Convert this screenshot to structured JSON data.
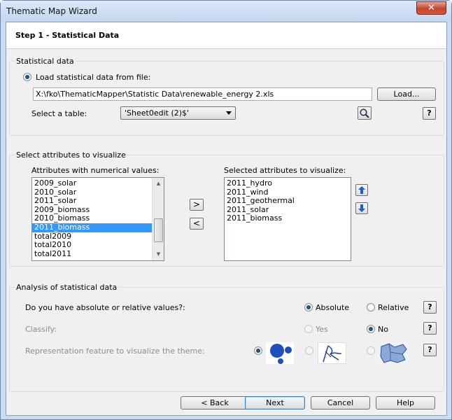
{
  "window": {
    "title": "Thematic Map Wizard",
    "close_glyph": "✕"
  },
  "header": {
    "step_title": "Step 1 - Statistical Data"
  },
  "statistical": {
    "group_label": "Statistical data",
    "load_radio_label": "Load statistical data from file:",
    "file_path": "X:\\fko\\ThematicMapper\\Statistic Data\\renewable_energy 2.xls",
    "load_button": "Load...",
    "select_table_label": "Select a table:",
    "table_value": "'Sheet0edit (2)$'",
    "help_label": "?"
  },
  "attributes": {
    "group_label": "Select attributes to visualize",
    "numerical_label": "Attributes with numerical values:",
    "numerical_items": [
      "2009_solar",
      "2010_solar",
      "2011_solar",
      "2009_biomass",
      "2010_biomass",
      "2011_biomass",
      "total2009",
      "total2010",
      "total2011"
    ],
    "selected_index": 5,
    "add_label": ">",
    "remove_label": "<",
    "selected_label": "Selected attributes to visualize:",
    "selected_items": [
      "2011_hydro",
      "2011_wind",
      "2011_geothermal",
      "2011_solar",
      "2011_biomass"
    ]
  },
  "analysis": {
    "group_label": "Analysis of statistical data",
    "values_question": "Do you have absolute or relative values?:",
    "absolute_label": "Absolute",
    "relative_label": "Relative",
    "classify_label": "Classify:",
    "yes_label": "Yes",
    "no_label": "No",
    "representation_label": "Representation feature to visualize the theme:",
    "help_label": "?"
  },
  "footer": {
    "back": "< Back",
    "next": "Next",
    "cancel": "Cancel",
    "help": "Help"
  },
  "colors": {
    "selection": "#3399ff",
    "arrow_blue": "#1f5ebd",
    "map_blue": "#8aa8d8"
  }
}
